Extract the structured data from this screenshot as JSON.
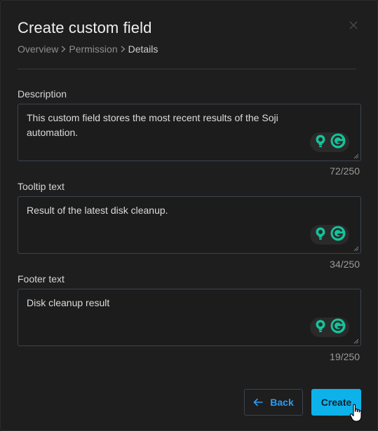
{
  "dialog": {
    "title": "Create custom field",
    "breadcrumb": [
      "Overview",
      "Permission",
      "Details"
    ]
  },
  "fields": [
    {
      "label": "Description",
      "value": "This custom field stores the most recent results of the Soji automation.",
      "counter": "72/250"
    },
    {
      "label": "Tooltip text",
      "value": "Result of the latest disk cleanup.",
      "counter": "34/250"
    },
    {
      "label": "Footer text",
      "value": "Disk cleanup result",
      "counter": "19/250"
    }
  ],
  "buttons": {
    "back_label": "Back",
    "create_label": "Create"
  },
  "icons": {
    "close": "close-icon",
    "breadcrumb_separator": "chevron-right-icon",
    "back_arrow": "arrow-left-icon",
    "grammar_hint": "lightbulb-icon",
    "grammar_logo": "grammarly-icon",
    "cursor": "hand-pointer-icon"
  },
  "colors": {
    "accent": "#0eb2ea",
    "link": "#2a9df4",
    "grammar_green": "#15c39a"
  }
}
